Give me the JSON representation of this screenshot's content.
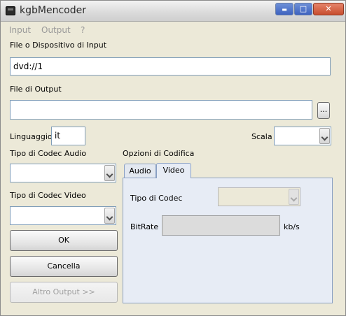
{
  "window": {
    "title": "kgbMencoder"
  },
  "titlebar": {
    "minimize": "▬",
    "maximize": "□",
    "close": "✕"
  },
  "menu": [
    "Input",
    "Output",
    "?"
  ],
  "input_section": {
    "label": "File o Dispositivo di Input",
    "value": "dvd://1"
  },
  "output_section": {
    "label": "File di Output",
    "value": "",
    "browse_label": "..."
  },
  "language": {
    "label": "Linguaggio",
    "value": "it"
  },
  "scale": {
    "label": "Scala",
    "value": ""
  },
  "audio_codec": {
    "label": "Tipo di Codec Audio",
    "value": ""
  },
  "video_codec": {
    "label": "Tipo di Codec Video",
    "value": ""
  },
  "buttons": {
    "ok": "OK",
    "cancel": "Cancella",
    "more": "Altro Output >>"
  },
  "encoding_options": {
    "label": "Opzioni di Codifica",
    "tabs": [
      "Audio",
      "Video"
    ],
    "active_tab": "Video",
    "codec_type_label": "Tipo di Codec",
    "bitrate_label": "BitRate",
    "bitrate_unit": "kb/s"
  }
}
